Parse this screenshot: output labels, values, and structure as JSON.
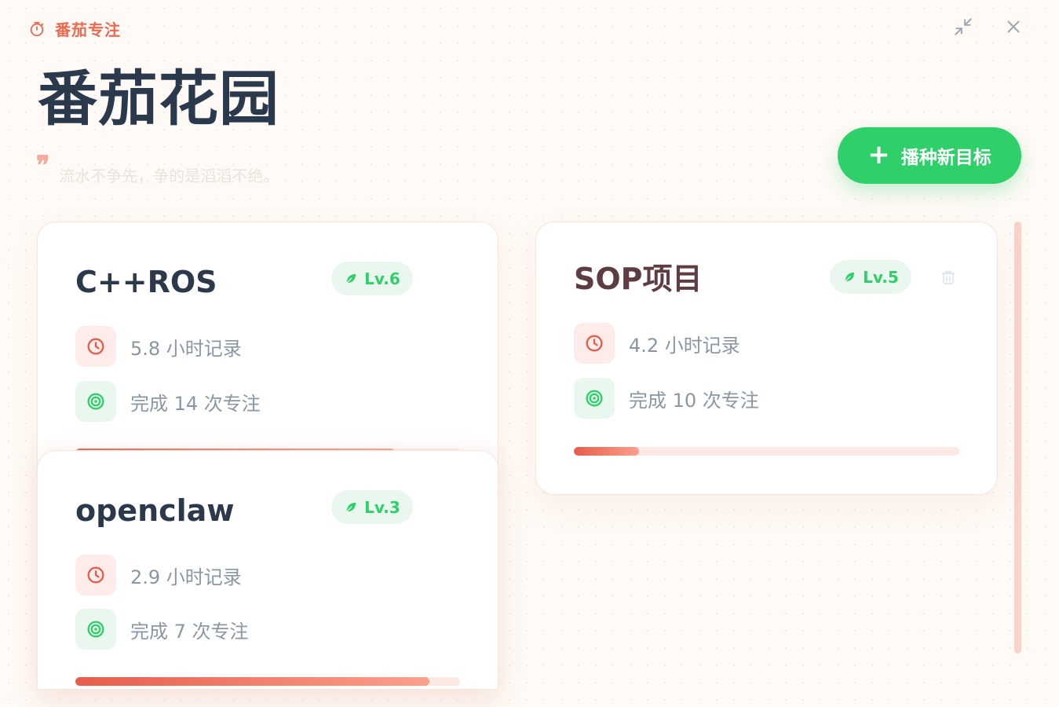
{
  "app": {
    "title": "番茄专注"
  },
  "page": {
    "heading": "番茄花园",
    "quote": "流水不争先，争的是滔滔不绝。"
  },
  "actions": {
    "add_goal_label": "播种新目标"
  },
  "icons": {
    "brand": "stopwatch-icon",
    "minimize": "minimize-icon",
    "close": "close-icon",
    "quote": "quote-icon",
    "leaf": "leaf-icon",
    "clock": "clock-icon",
    "target": "target-icon",
    "trash": "trash-icon",
    "add": "plus-icon"
  },
  "colors": {
    "background": "#fffaf6",
    "accent_red": "#ea6b52",
    "accent_green": "#2fcf6a",
    "title_dark": "#2a3a4c",
    "title_warm": "#5e3d42",
    "muted_text": "#8a97a3"
  },
  "goals": [
    {
      "name": "C++ROS",
      "level": "Lv.6",
      "hours": "5.8 小时记录",
      "sessions": "完成 14 次专注",
      "progress": 0.83
    },
    {
      "name": "openclaw",
      "level": "Lv.3",
      "hours": "2.9 小时记录",
      "sessions": "完成 7 次专注",
      "progress": 0.92
    },
    {
      "name": "SOP项目",
      "level": "Lv.5",
      "hours": "4.2 小时记录",
      "sessions": "完成 10 次专注",
      "progress": 0.17
    }
  ]
}
